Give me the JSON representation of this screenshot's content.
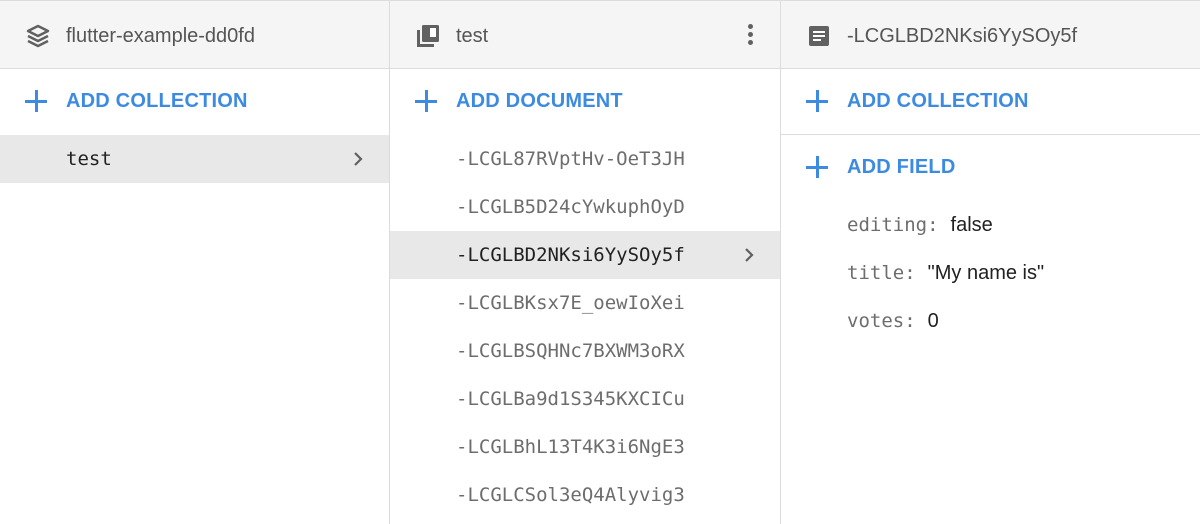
{
  "panel1": {
    "title": "flutter-example-dd0fd",
    "icon": "firebase-layers-icon",
    "add_label": "ADD COLLECTION",
    "items": [
      {
        "label": "test"
      }
    ]
  },
  "panel2": {
    "title": "test",
    "icon": "collection-icon",
    "add_label": "ADD DOCUMENT",
    "items": [
      {
        "label": "-LCGL87RVptHv-OeT3JH"
      },
      {
        "label": "-LCGLB5D24cYwkuphOyD"
      },
      {
        "label": "-LCGLBD2NKsi6YySOy5f"
      },
      {
        "label": "-LCGLBKsx7E_oewIoXei"
      },
      {
        "label": "-LCGLBSQHNc7BXWM3oRX"
      },
      {
        "label": "-LCGLBa9d1S345KXCICu"
      },
      {
        "label": "-LCGLBhL13T4K3i6NgE3"
      },
      {
        "label": "-LCGLCSol3eQ4Alyvig3"
      }
    ]
  },
  "panel3": {
    "title": "-LCGLBD2NKsi6YySOy5f",
    "icon": "document-icon",
    "add_collection_label": "ADD COLLECTION",
    "add_field_label": "ADD FIELD",
    "fields": [
      {
        "key": "editing:",
        "value": "false"
      },
      {
        "key": "title:",
        "value": "\"My name is\""
      },
      {
        "key": "votes:",
        "value": "0"
      }
    ]
  },
  "colors": {
    "accent": "#3c8be0",
    "header_bg": "#f5f5f5",
    "selected_bg": "#e8e8e8"
  }
}
